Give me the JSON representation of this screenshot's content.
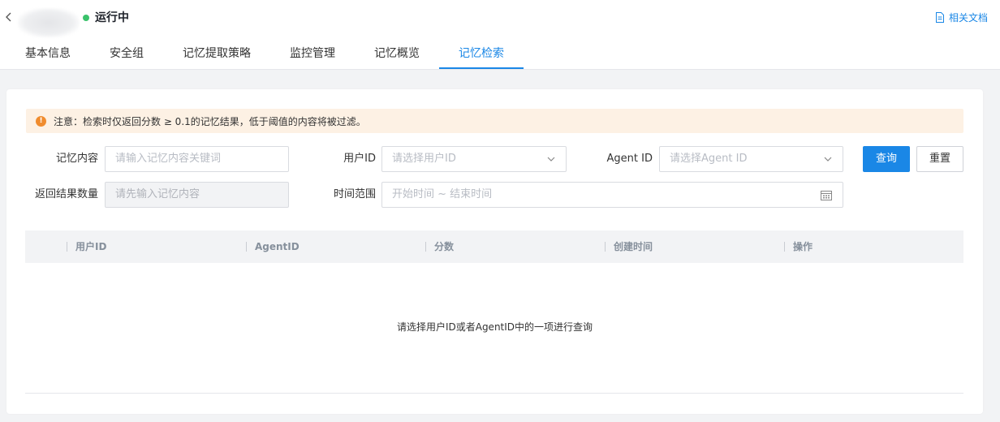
{
  "header": {
    "status_text": "运行中",
    "status_color": "#3ac26b",
    "doc_link_label": "相关文档",
    "back_icon": "chevron-left-icon",
    "doc_icon": "document-icon"
  },
  "tabs": [
    {
      "label": "基本信息",
      "active": false
    },
    {
      "label": "安全组",
      "active": false
    },
    {
      "label": "记忆提取策略",
      "active": false
    },
    {
      "label": "监控管理",
      "active": false
    },
    {
      "label": "记忆概览",
      "active": false
    },
    {
      "label": "记忆检索",
      "active": true
    }
  ],
  "notice": {
    "text": "注意：检索时仅返回分数 ≥ 0.1的记忆结果，低于阈值的内容将被过滤。",
    "icon": "warning-icon"
  },
  "form": {
    "memory_content": {
      "label": "记忆内容",
      "placeholder": "请输入记忆内容关键词"
    },
    "user_id": {
      "label": "用户ID",
      "placeholder": "请选择用户ID"
    },
    "agent_id": {
      "label": "Agent ID",
      "placeholder": "请选择Agent ID"
    },
    "result_count": {
      "label": "返回结果数量",
      "placeholder": "请先输入记忆内容",
      "disabled": true
    },
    "time_range": {
      "label": "时间范围",
      "placeholder": "开始时间 ~ 结束时间"
    },
    "query_button": "查询",
    "reset_button": "重置"
  },
  "table": {
    "columns": [
      "用户ID",
      "AgentID",
      "分数",
      "创建时间",
      "操作"
    ],
    "rows": [],
    "empty_text": "请选择用户ID或者AgentID中的一项进行查询"
  },
  "colors": {
    "accent": "#1a87e6",
    "notice_bg": "#fdf1e4",
    "warning": "#f08c2e"
  }
}
